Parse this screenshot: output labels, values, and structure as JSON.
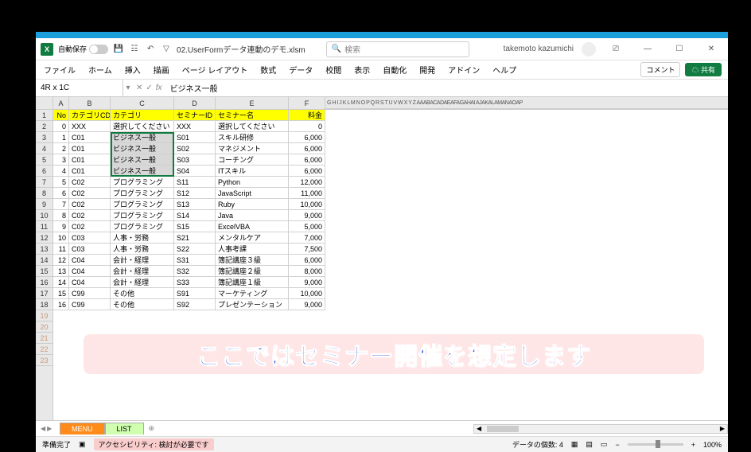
{
  "app": {
    "autosave_label": "自動保存",
    "filename": "02.UserFormデータ連動のデモ.xlsm",
    "search_placeholder": "検索",
    "account": "takemoto kazumichi",
    "comment_btn": "コメント",
    "share_btn": "共有"
  },
  "ribbon": {
    "tabs": [
      "ファイル",
      "ホーム",
      "挿入",
      "描画",
      "ページ レイアウト",
      "数式",
      "データ",
      "校閲",
      "表示",
      "自動化",
      "開発",
      "アドイン",
      "ヘルプ"
    ]
  },
  "formula": {
    "namebox": "4R x 1C",
    "value": "ビジネス一般"
  },
  "columns": [
    "A",
    "B",
    "C",
    "D",
    "E",
    "F"
  ],
  "extra_cols": "G  H  I  J  K  L  M  N  O  P  Q  R  S  T  U  V  W  X  Y  Z AAABACADAEAFAGAHAI AJAKALAMANAOAP",
  "headers": [
    "No",
    "カテゴリCD",
    "カテゴリ",
    "セミナーID",
    "セミナー名",
    "料金"
  ],
  "rows": [
    [
      "0",
      "XXX",
      "選択してください",
      "XXX",
      "選択してください",
      "0"
    ],
    [
      "1",
      "C01",
      "ビジネス一般",
      "S01",
      "スキル研修",
      "6,000"
    ],
    [
      "2",
      "C01",
      "ビジネス一般",
      "S02",
      "マネジメント",
      "6,000"
    ],
    [
      "3",
      "C01",
      "ビジネス一般",
      "S03",
      "コーチング",
      "6,000"
    ],
    [
      "4",
      "C01",
      "ビジネス一般",
      "S04",
      "ITスキル",
      "6,000"
    ],
    [
      "5",
      "C02",
      "プログラミング",
      "S11",
      "Python",
      "12,000"
    ],
    [
      "6",
      "C02",
      "プログラミング",
      "S12",
      "JavaScript",
      "11,000"
    ],
    [
      "7",
      "C02",
      "プログラミング",
      "S13",
      "Ruby",
      "10,000"
    ],
    [
      "8",
      "C02",
      "プログラミング",
      "S14",
      "Java",
      "9,000"
    ],
    [
      "9",
      "C02",
      "プログラミング",
      "S15",
      "ExcelVBA",
      "5,000"
    ],
    [
      "10",
      "C03",
      "人事・労務",
      "S21",
      "メンタルケア",
      "7,000"
    ],
    [
      "11",
      "C03",
      "人事・労務",
      "S22",
      "人事考課",
      "7,500"
    ],
    [
      "12",
      "C04",
      "会計・経理",
      "S31",
      "簿記講座３級",
      "6,000"
    ],
    [
      "13",
      "C04",
      "会計・経理",
      "S32",
      "簿記講座２級",
      "8,000"
    ],
    [
      "14",
      "C04",
      "会計・経理",
      "S33",
      "簿記講座１級",
      "9,000"
    ],
    [
      "15",
      "C99",
      "その他",
      "S91",
      "マーケティング",
      "10,000"
    ],
    [
      "16",
      "C99",
      "その他",
      "S92",
      "プレゼンテーション",
      "9,000"
    ]
  ],
  "sheet_tabs": {
    "menu": "MENU",
    "list": "LIST"
  },
  "statusbar": {
    "ready": "準備完了",
    "access": "アクセシビリティ: 検討が必要です",
    "count": "データの個数: 4",
    "zoom": "100%"
  },
  "caption": "ここではセミナー開催を想定します"
}
